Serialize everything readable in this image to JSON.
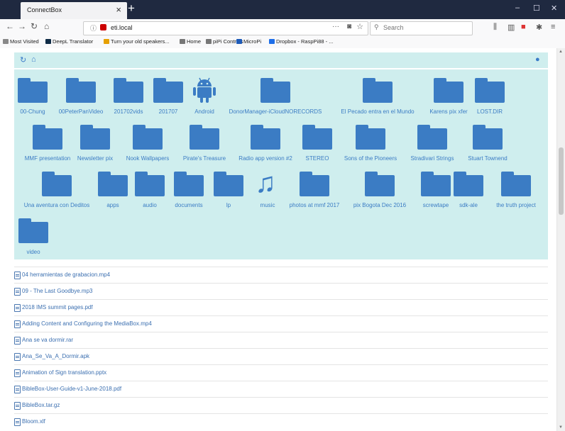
{
  "browser": {
    "tab_title": "ConnectBox",
    "tab_close": "×",
    "new_tab": "+",
    "win_min": "–",
    "win_max": "☐",
    "win_close": "✕",
    "url": "eti.local",
    "url_actions": "···",
    "search_placeholder": "Search"
  },
  "bookmarks": [
    {
      "label": "Most Visited",
      "color": "#888888"
    },
    {
      "label": "DeepL Translator",
      "color": "#0f2b46"
    },
    {
      "label": "Turn your old speakers...",
      "color": "#e6a000"
    },
    {
      "label": "Home",
      "color": "#777777"
    },
    {
      "label": "piPi Controls",
      "color": "#777777"
    },
    {
      "label": "MicroPi",
      "color": "#1e5bb8"
    },
    {
      "label": "Dropbox - RaspPi88 - ...",
      "color": "#1e6ee8"
    }
  ],
  "folders": [
    {
      "label": "00-Chung",
      "type": "folder"
    },
    {
      "label": "00PeterPanVideo",
      "type": "folder"
    },
    {
      "label": "201702vids",
      "type": "folder"
    },
    {
      "label": "201707",
      "type": "folder"
    },
    {
      "label": "Android",
      "type": "android"
    },
    {
      "label": "DonorManager-iCloudNORECORDS",
      "type": "folder"
    },
    {
      "label": "El Pecado entra en el Mundo",
      "type": "folder"
    },
    {
      "label": "Karens pix xfer",
      "type": "folder"
    },
    {
      "label": "LOST.DIR",
      "type": "folder"
    },
    {
      "label": "MMF presentation",
      "type": "folder"
    },
    {
      "label": "Newsletter pix",
      "type": "folder"
    },
    {
      "label": "Nook Wallpapers",
      "type": "folder"
    },
    {
      "label": "Pirate's Treasure",
      "type": "folder"
    },
    {
      "label": "Radio app version #2",
      "type": "folder"
    },
    {
      "label": "STEREO",
      "type": "folder"
    },
    {
      "label": "Sons of the Pioneers",
      "type": "folder"
    },
    {
      "label": "Stradivari Strings",
      "type": "folder"
    },
    {
      "label": "Stuart Townend",
      "type": "folder"
    },
    {
      "label": "Una aventura con Deditos",
      "type": "folder"
    },
    {
      "label": "apps",
      "type": "folder"
    },
    {
      "label": "audio",
      "type": "folder"
    },
    {
      "label": "documents",
      "type": "folder"
    },
    {
      "label": "lp",
      "type": "folder"
    },
    {
      "label": "music",
      "type": "music"
    },
    {
      "label": "photos at mmf 2017",
      "type": "folder"
    },
    {
      "label": "pix Bogota Dec 2016",
      "type": "folder"
    },
    {
      "label": "screwtape",
      "type": "folder"
    },
    {
      "label": "sdk-ale",
      "type": "folder"
    },
    {
      "label": "the truth project",
      "type": "folder"
    },
    {
      "label": "video",
      "type": "folder"
    }
  ],
  "files": [
    "04 herramientas de grabacion.mp4",
    "09 - The Last Goodbye.mp3",
    "2018 IMS summit pages.pdf",
    "Adding Content and Configuring the MediaBox.mp4",
    "Ana se va dormir.rar",
    "Ana_Se_Va_A_Dormir.apk",
    "Animation of Sign translation.pptx",
    "BibleBox-User-Guide-v1-June-2018.pdf",
    "BibleBox.tar.gz",
    "Bloom.xlf"
  ],
  "icons": {
    "refresh": "refresh-icon",
    "home": "home-icon",
    "chat": "chat-icon"
  },
  "colors": {
    "accent": "#3b7cc4",
    "panel_bg": "#cfeeee",
    "titlebar": "#1f2940"
  }
}
